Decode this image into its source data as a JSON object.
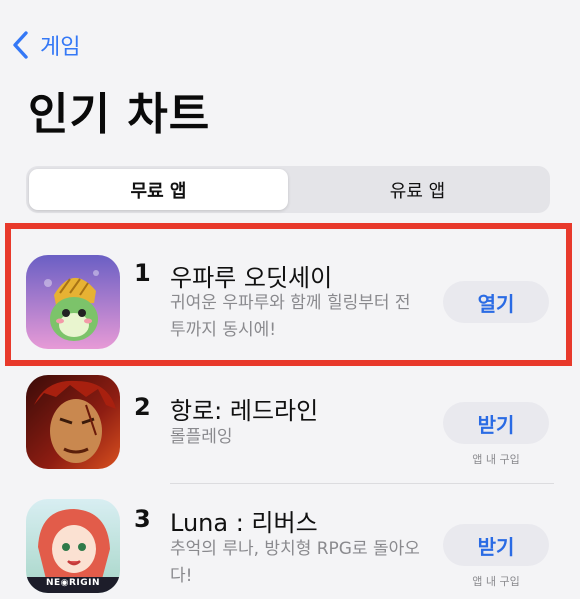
{
  "nav": {
    "back_label": "게임"
  },
  "title": "인기 차트",
  "segments": {
    "free": "무료 앱",
    "paid": "유료 앱",
    "selected": "무료 앱"
  },
  "apps": [
    {
      "rank": "1",
      "name": "우파루 오딧세이",
      "subtitle": "귀여운 우파루와 함께 힐링부터 전투까지 동시에!",
      "button": "열기",
      "note": ""
    },
    {
      "rank": "2",
      "name": "항로: 레드라인",
      "subtitle": "롤플레잉",
      "button": "받기",
      "note": "앱 내 구입"
    },
    {
      "rank": "3",
      "name": "Luna : 리버스",
      "subtitle": "추억의 루나, 방치형 RPG로 돌아오다!",
      "button": "받기",
      "note": "앱 내 구입",
      "icon_text": "NE◉RIGIN"
    }
  ],
  "colors": {
    "accent": "#3478f6",
    "highlight": "#e8392b"
  }
}
